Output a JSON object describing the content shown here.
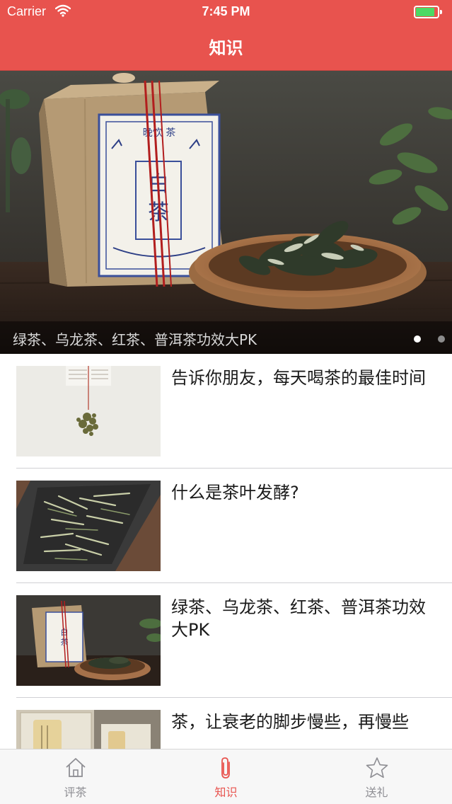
{
  "status_bar": {
    "carrier": "Carrier",
    "time": "7:45 PM",
    "battery_level": 0.85,
    "battery_color": "#4cd964"
  },
  "nav": {
    "title": "知识",
    "background": "#e8534e"
  },
  "banner": {
    "caption": "绿茶、乌龙茶、红茶、普洱茶功效大PK",
    "page_count": 2,
    "current_page": 1,
    "image": "white tea package and tea leaves in wooden tray"
  },
  "articles": [
    {
      "title": "告诉你朋友，每天喝茶的最佳时间",
      "thumb": "tea-leaves-falling-icon"
    },
    {
      "title": "什么是茶叶发酵?",
      "thumb": "white-tea-tray-icon"
    },
    {
      "title": "绿茶、乌龙茶、红茶、普洱茶功效大PK",
      "thumb": "tea-package-icon"
    },
    {
      "title": "茶，让衰老的脚步慢些，再慢些",
      "thumb": "tea-canisters-icon"
    }
  ],
  "tabs": [
    {
      "label": "评茶",
      "icon": "house-icon",
      "active": false
    },
    {
      "label": "知识",
      "icon": "paperclip-icon",
      "active": true
    },
    {
      "label": "送礼",
      "icon": "star-icon",
      "active": false
    }
  ],
  "colors": {
    "accent": "#e8534e",
    "tab_inactive": "#8e8e93"
  }
}
